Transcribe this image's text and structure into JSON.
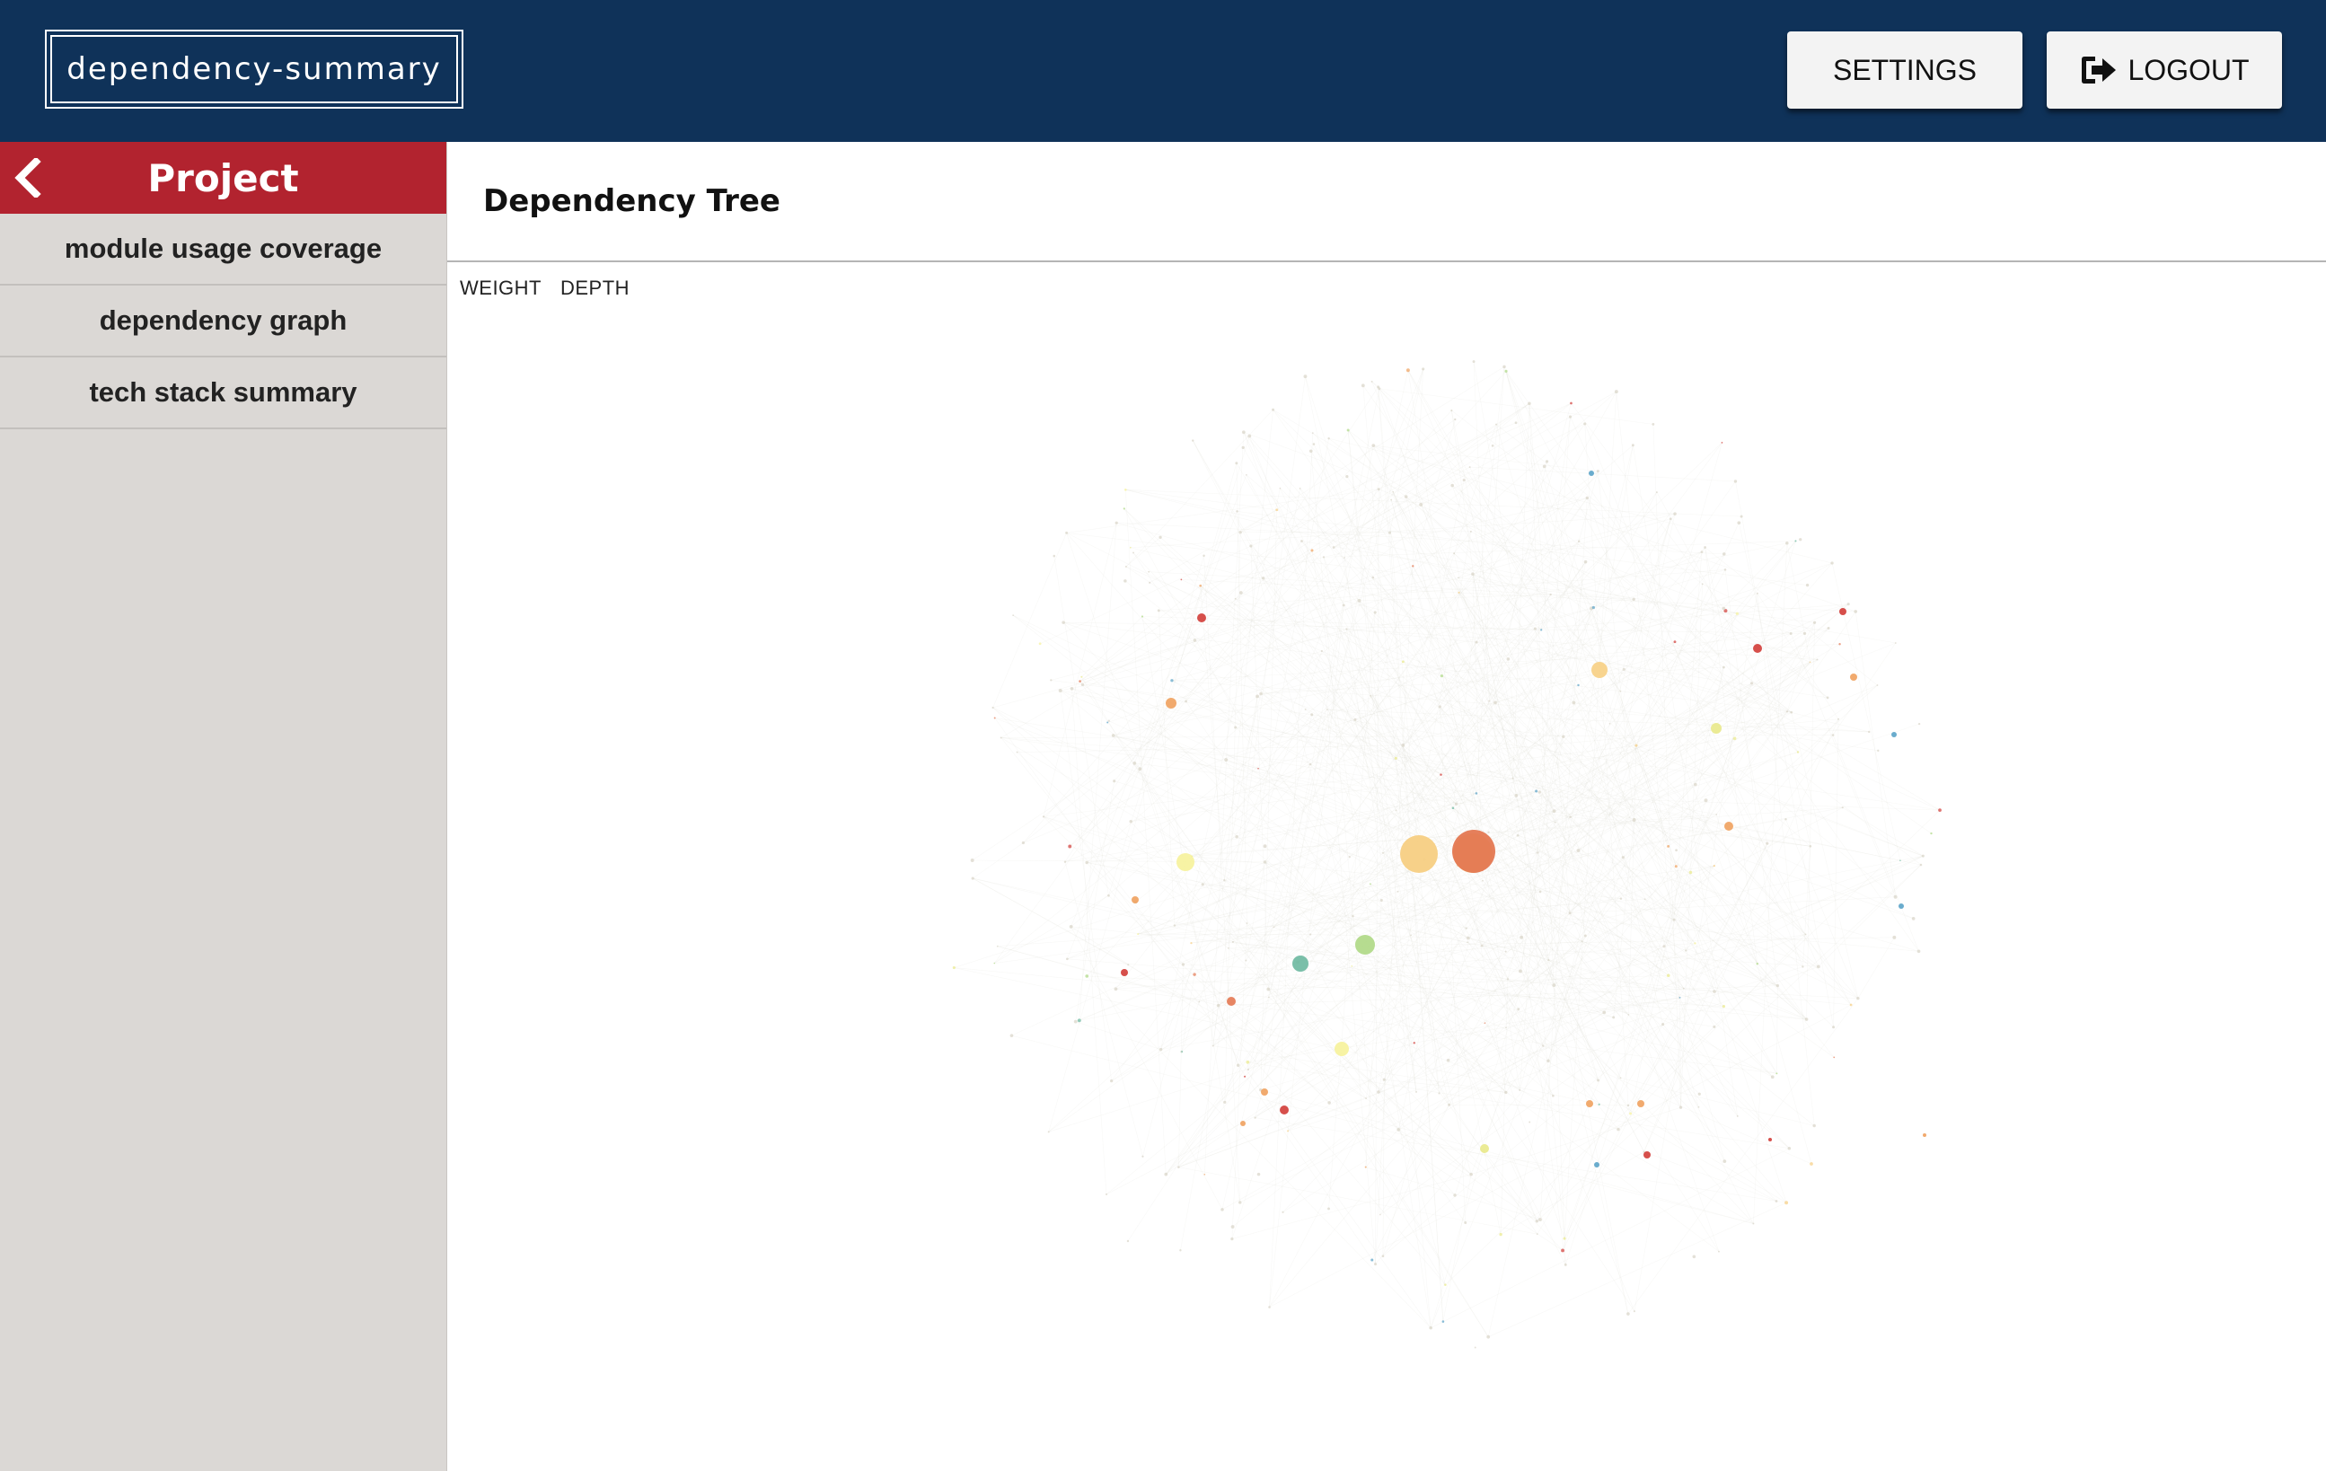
{
  "header": {
    "brand": "dependency-summary",
    "settings_label": "SETTINGS",
    "logout_label": "LOGOUT",
    "logout_icon": "sign-out-icon"
  },
  "sidebar": {
    "back_icon": "chevron-left-icon",
    "title": "Project",
    "items": [
      {
        "label": "module usage coverage"
      },
      {
        "label": "dependency graph"
      },
      {
        "label": "tech stack summary"
      }
    ]
  },
  "main": {
    "title": "Dependency Tree",
    "toggles": [
      {
        "label": "WEIGHT"
      },
      {
        "label": "DEPTH"
      }
    ]
  },
  "colors": {
    "topbar": "#0f3259",
    "sidebar_header": "#b2232f",
    "sidebar_bg": "#dbd8d5",
    "node_palette": [
      "#f7cf83",
      "#e47852",
      "#aed884",
      "#6bb8a0",
      "#f6f29a",
      "#d23c37",
      "#f0a15e",
      "#5aa3c8",
      "#e9e98a"
    ]
  }
}
